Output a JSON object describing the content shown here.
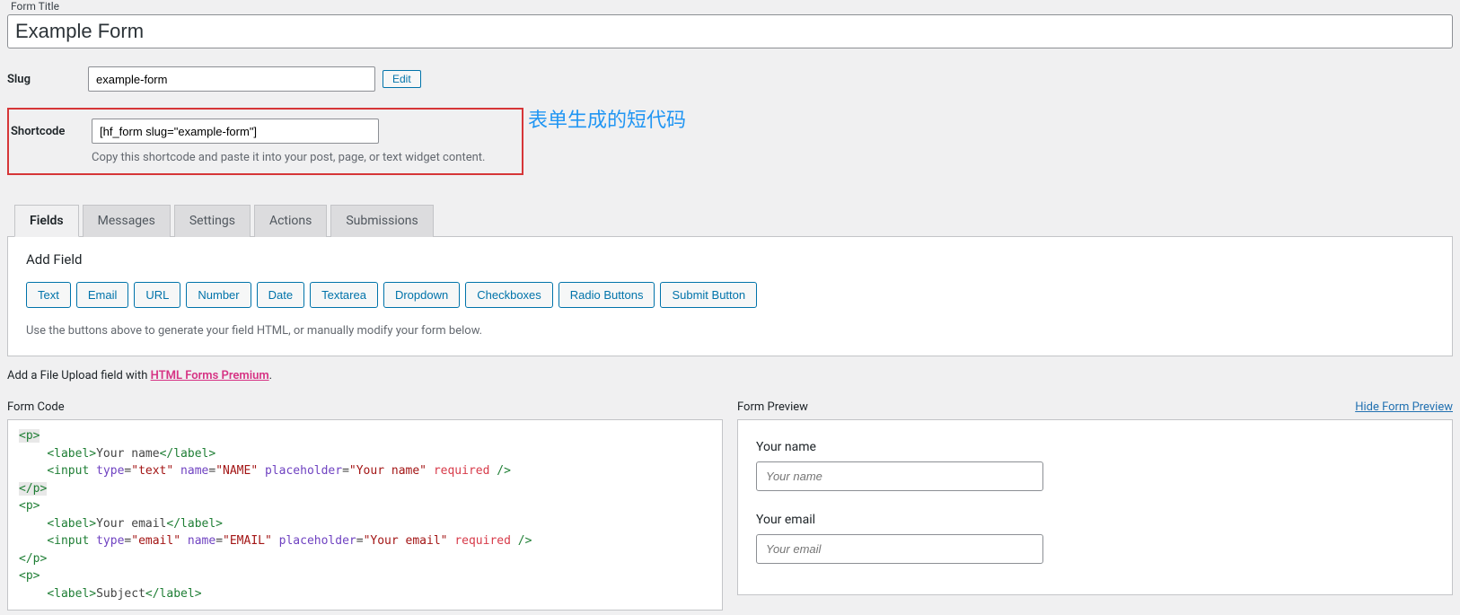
{
  "form_title": {
    "label": "Form Title",
    "value": "Example Form"
  },
  "slug": {
    "label": "Slug",
    "value": "example-form",
    "edit_label": "Edit"
  },
  "shortcode": {
    "label": "Shortcode",
    "value": "[hf_form slug=\"example-form\"]",
    "help": "Copy this shortcode and paste it into your post, page, or text widget content."
  },
  "annotation": "表单生成的短代码",
  "tabs": [
    {
      "label": "Fields",
      "active": true
    },
    {
      "label": "Messages",
      "active": false
    },
    {
      "label": "Settings",
      "active": false
    },
    {
      "label": "Actions",
      "active": false
    },
    {
      "label": "Submissions",
      "active": false
    }
  ],
  "add_field": {
    "title": "Add Field",
    "buttons": [
      "Text",
      "Email",
      "URL",
      "Number",
      "Date",
      "Textarea",
      "Dropdown",
      "Checkboxes",
      "Radio Buttons",
      "Submit Button"
    ],
    "help": "Use the buttons above to generate your field HTML, or manually modify your form below."
  },
  "upload_note": {
    "prefix": "Add a File Upload field with ",
    "link_text": "HTML Forms Premium",
    "suffix": "."
  },
  "form_code": {
    "title": "Form Code",
    "lines": [
      {
        "type": "p-open-hl"
      },
      {
        "type": "label",
        "text": "Your name"
      },
      {
        "type": "input",
        "itype": "text",
        "name": "NAME",
        "placeholder": "Your name",
        "required": true
      },
      {
        "type": "p-close-hl"
      },
      {
        "type": "p-open"
      },
      {
        "type": "label",
        "text": "Your email"
      },
      {
        "type": "input",
        "itype": "email",
        "name": "EMAIL",
        "placeholder": "Your email",
        "required": true
      },
      {
        "type": "p-close"
      },
      {
        "type": "p-open"
      },
      {
        "type": "label-partial",
        "text": "Subject"
      }
    ]
  },
  "form_preview": {
    "title": "Form Preview",
    "hide_link": "Hide Form Preview",
    "fields": [
      {
        "label": "Your name",
        "placeholder": "Your name"
      },
      {
        "label": "Your email",
        "placeholder": "Your email"
      }
    ]
  }
}
